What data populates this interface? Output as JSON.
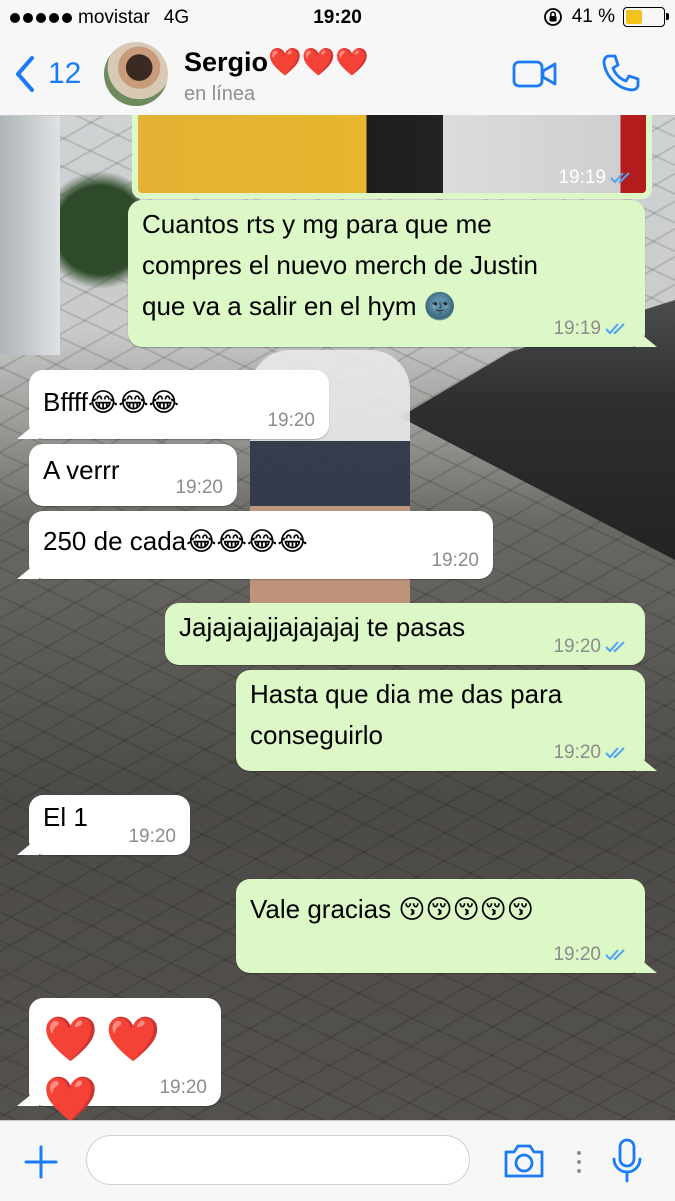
{
  "status_bar": {
    "carrier": "movistar",
    "network": "4G",
    "time": "19:20",
    "battery_percent": "41 %",
    "battery_level": 0.41
  },
  "header": {
    "back_count": "12",
    "contact_name": "Sergio❤️❤️❤️",
    "contact_status": "en línea"
  },
  "messages": [
    {
      "side": "out",
      "text": "",
      "time": "19:19",
      "type": "image"
    },
    {
      "side": "out",
      "text": "Cuantos rts y mg para que me\ncompres el nuevo merch de Justin\nque va a salir en el hym 🌚",
      "time": "19:19"
    },
    {
      "side": "in",
      "text": "Bffff😂😂😂",
      "time": "19:20"
    },
    {
      "side": "in",
      "text": "A verrr",
      "time": "19:20"
    },
    {
      "side": "in",
      "text": "250 de cada😂😂😂😂",
      "time": "19:20"
    },
    {
      "side": "out",
      "text": "Jajajajajjajajajaj te pasas",
      "time": "19:20"
    },
    {
      "side": "out",
      "text": "Hasta que dia me das para\nconseguirlo",
      "time": "19:20"
    },
    {
      "side": "in",
      "text": "El 1",
      "time": "19:20"
    },
    {
      "side": "out",
      "text": "Vale gracias 😚😚😚😚😚",
      "time": "19:20"
    },
    {
      "side": "in",
      "text": "❤️❤️❤️",
      "time": "19:20"
    }
  ],
  "colors": {
    "accent": "#1a7cf5",
    "outgoing_bubble": "#dcf8c6",
    "incoming_bubble": "#ffffff",
    "read_ticks": "#4fa3f7"
  },
  "icons": {
    "back": "chevron-left-icon",
    "video": "video-call-icon",
    "phone": "phone-icon",
    "add": "plus-icon",
    "camera": "camera-icon",
    "mic": "microphone-icon"
  }
}
